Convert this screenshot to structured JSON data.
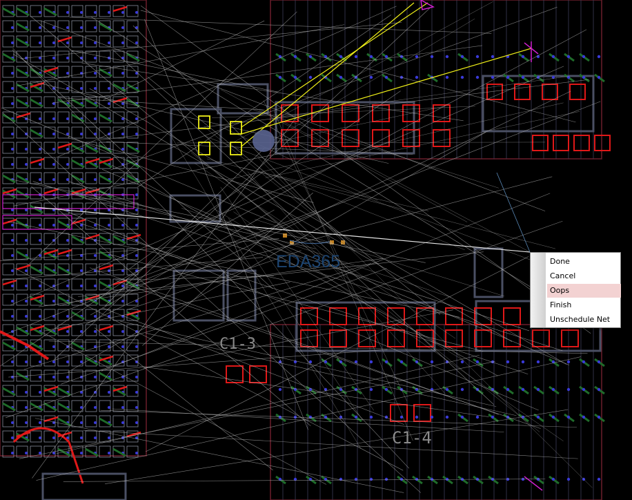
{
  "canvas": {
    "watermark": "EDA365",
    "silk_labels": [
      "C1-3",
      "C1-4"
    ]
  },
  "context_menu": {
    "items": [
      {
        "label": "Done",
        "name": "menu-item-done",
        "highlighted": false
      },
      {
        "label": "Cancel",
        "name": "menu-item-cancel",
        "highlighted": false
      },
      {
        "label": "Oops",
        "name": "menu-item-oops",
        "highlighted": true
      },
      {
        "label": "Finish",
        "name": "menu-item-finish",
        "highlighted": false
      },
      {
        "label": "Unschedule Net",
        "name": "menu-item-unschedule-net",
        "highlighted": false
      }
    ]
  },
  "colors": {
    "board_bg": "#000000",
    "ratsnest": "#b8b8b8",
    "pad_red": "#e01818",
    "outline_gray": "#4a4f63",
    "trace_green": "#1f6b2a",
    "via_blue": "#3a3ad8",
    "highlight_yellow": "#f0f018",
    "magenta": "#d020d0",
    "menu_highlight": "#f3d2d2"
  }
}
